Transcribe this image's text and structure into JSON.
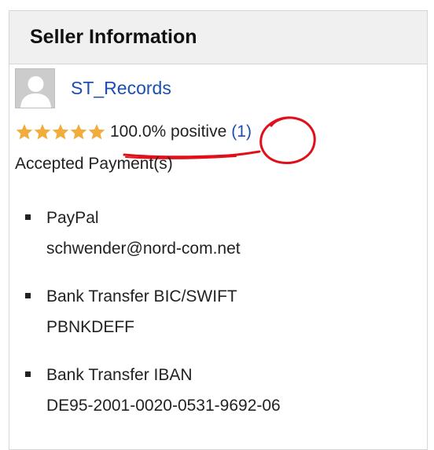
{
  "panel": {
    "title": "Seller Information"
  },
  "seller": {
    "name": "ST_Records",
    "avatar_icon": "default-user-avatar-icon"
  },
  "rating": {
    "stars": 5,
    "max_stars": 5,
    "star_color": "#f2ac3c",
    "positive_text": "100.0% positive",
    "feedback_count": "(1)"
  },
  "payments": {
    "label": "Accepted Payment(s)",
    "items": [
      {
        "method": "PayPal",
        "detail": "schwender@nord-com.net"
      },
      {
        "method": "Bank Transfer BIC/SWIFT",
        "detail": "PBNKDEFF"
      },
      {
        "method": "Bank Transfer IBAN",
        "detail": "DE95-2001-0020-0531-9692-06"
      }
    ]
  },
  "colors": {
    "link": "#1a4fb0",
    "header_bg": "#f0f0f0",
    "annotation": "#e0101a"
  }
}
